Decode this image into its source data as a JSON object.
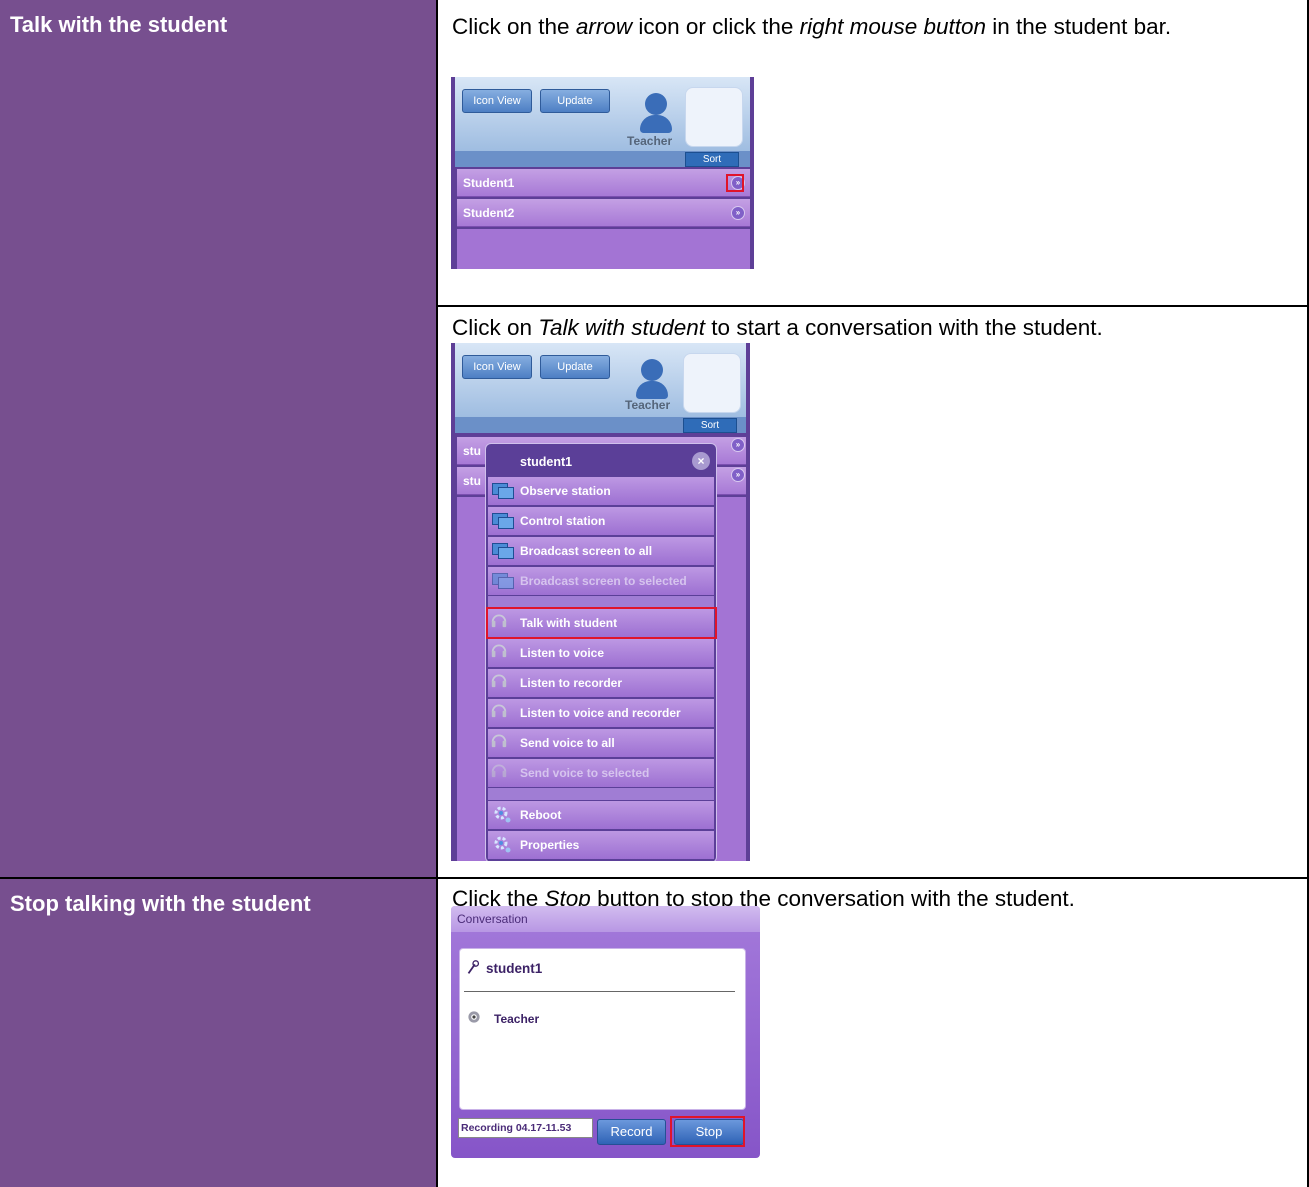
{
  "rows": [
    {
      "left_label": "Talk with the student",
      "steps": [
        {
          "instruction_parts": [
            "Click on the ",
            "arrow",
            " icon or click the ",
            "right mouse button",
            " in the student bar."
          ]
        },
        {
          "instruction_parts": [
            "Click on ",
            "Talk with student",
            " to start a conversation with the student."
          ]
        }
      ]
    },
    {
      "left_label": "Stop talking with the student",
      "steps": [
        {
          "instruction_parts": [
            "Click the ",
            "Stop",
            " button to stop the conversation with the student."
          ]
        }
      ]
    }
  ],
  "shot1": {
    "buttons": {
      "icon_view": "Icon View",
      "update": "Update",
      "sort": "Sort"
    },
    "teacher": "Teacher",
    "students": [
      "Student1",
      "Student2"
    ],
    "arrow_glyph": "»"
  },
  "shot2": {
    "buttons": {
      "icon_view": "Icon View",
      "update": "Update",
      "sort": "Sort"
    },
    "teacher": "Teacher",
    "students_truncated": [
      "stu",
      "stu"
    ],
    "arrow_glyph": "»",
    "menu": {
      "title": "student1",
      "close_glyph": "×",
      "groups": [
        [
          {
            "label": "Observe station",
            "icon": "monitor-icon",
            "enabled": true
          },
          {
            "label": "Control station",
            "icon": "monitor-icon",
            "enabled": true
          },
          {
            "label": "Broadcast screen to all",
            "icon": "monitor-icon",
            "enabled": true
          },
          {
            "label": "Broadcast screen to selected",
            "icon": "monitor-icon",
            "enabled": false
          }
        ],
        [
          {
            "label": "Talk with student",
            "icon": "headphones-icon",
            "enabled": true,
            "highlighted": true
          },
          {
            "label": "Listen to voice",
            "icon": "headphones-icon",
            "enabled": true
          },
          {
            "label": "Listen to recorder",
            "icon": "headphones-icon",
            "enabled": true
          },
          {
            "label": "Listen to voice and recorder",
            "icon": "headphones-icon",
            "enabled": true
          },
          {
            "label": "Send voice to all",
            "icon": "headphones-icon",
            "enabled": true
          },
          {
            "label": "Send voice to selected",
            "icon": "headphones-icon",
            "enabled": false
          }
        ],
        [
          {
            "label": "Reboot",
            "icon": "gear-icon",
            "enabled": true
          },
          {
            "label": "Properties",
            "icon": "gear-icon",
            "enabled": true
          }
        ]
      ]
    }
  },
  "shot3": {
    "title": "Conversation",
    "participants": [
      {
        "name": "student1",
        "icon": "microphone-icon"
      },
      {
        "name": "Teacher",
        "icon": "speaker-icon"
      }
    ],
    "recording_name": "Recording 04.17-11.53",
    "record_label": "Record",
    "stop_label": "Stop"
  },
  "colors": {
    "left_cell": "#774f8f",
    "highlight": "#e0142a",
    "menu_bg": "#5b3f98"
  }
}
